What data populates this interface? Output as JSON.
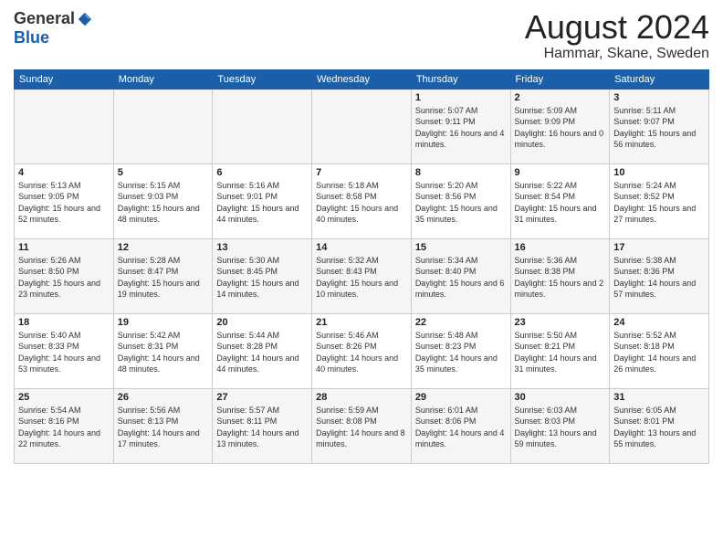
{
  "logo": {
    "general": "General",
    "blue": "Blue"
  },
  "title": "August 2024",
  "location": "Hammar, Skane, Sweden",
  "days_of_week": [
    "Sunday",
    "Monday",
    "Tuesday",
    "Wednesday",
    "Thursday",
    "Friday",
    "Saturday"
  ],
  "weeks": [
    [
      {
        "day": "",
        "info": ""
      },
      {
        "day": "",
        "info": ""
      },
      {
        "day": "",
        "info": ""
      },
      {
        "day": "",
        "info": ""
      },
      {
        "day": "1",
        "sunrise": "5:07 AM",
        "sunset": "9:11 PM",
        "daylight": "Daylight: 16 hours and 4 minutes."
      },
      {
        "day": "2",
        "sunrise": "5:09 AM",
        "sunset": "9:09 PM",
        "daylight": "Daylight: 16 hours and 0 minutes."
      },
      {
        "day": "3",
        "sunrise": "5:11 AM",
        "sunset": "9:07 PM",
        "daylight": "Daylight: 15 hours and 56 minutes."
      }
    ],
    [
      {
        "day": "4",
        "sunrise": "5:13 AM",
        "sunset": "9:05 PM",
        "daylight": "Daylight: 15 hours and 52 minutes."
      },
      {
        "day": "5",
        "sunrise": "5:15 AM",
        "sunset": "9:03 PM",
        "daylight": "Daylight: 15 hours and 48 minutes."
      },
      {
        "day": "6",
        "sunrise": "5:16 AM",
        "sunset": "9:01 PM",
        "daylight": "Daylight: 15 hours and 44 minutes."
      },
      {
        "day": "7",
        "sunrise": "5:18 AM",
        "sunset": "8:58 PM",
        "daylight": "Daylight: 15 hours and 40 minutes."
      },
      {
        "day": "8",
        "sunrise": "5:20 AM",
        "sunset": "8:56 PM",
        "daylight": "Daylight: 15 hours and 35 minutes."
      },
      {
        "day": "9",
        "sunrise": "5:22 AM",
        "sunset": "8:54 PM",
        "daylight": "Daylight: 15 hours and 31 minutes."
      },
      {
        "day": "10",
        "sunrise": "5:24 AM",
        "sunset": "8:52 PM",
        "daylight": "Daylight: 15 hours and 27 minutes."
      }
    ],
    [
      {
        "day": "11",
        "sunrise": "5:26 AM",
        "sunset": "8:50 PM",
        "daylight": "Daylight: 15 hours and 23 minutes."
      },
      {
        "day": "12",
        "sunrise": "5:28 AM",
        "sunset": "8:47 PM",
        "daylight": "Daylight: 15 hours and 19 minutes."
      },
      {
        "day": "13",
        "sunrise": "5:30 AM",
        "sunset": "8:45 PM",
        "daylight": "Daylight: 15 hours and 14 minutes."
      },
      {
        "day": "14",
        "sunrise": "5:32 AM",
        "sunset": "8:43 PM",
        "daylight": "Daylight: 15 hours and 10 minutes."
      },
      {
        "day": "15",
        "sunrise": "5:34 AM",
        "sunset": "8:40 PM",
        "daylight": "Daylight: 15 hours and 6 minutes."
      },
      {
        "day": "16",
        "sunrise": "5:36 AM",
        "sunset": "8:38 PM",
        "daylight": "Daylight: 15 hours and 2 minutes."
      },
      {
        "day": "17",
        "sunrise": "5:38 AM",
        "sunset": "8:36 PM",
        "daylight": "Daylight: 14 hours and 57 minutes."
      }
    ],
    [
      {
        "day": "18",
        "sunrise": "5:40 AM",
        "sunset": "8:33 PM",
        "daylight": "Daylight: 14 hours and 53 minutes."
      },
      {
        "day": "19",
        "sunrise": "5:42 AM",
        "sunset": "8:31 PM",
        "daylight": "Daylight: 14 hours and 48 minutes."
      },
      {
        "day": "20",
        "sunrise": "5:44 AM",
        "sunset": "8:28 PM",
        "daylight": "Daylight: 14 hours and 44 minutes."
      },
      {
        "day": "21",
        "sunrise": "5:46 AM",
        "sunset": "8:26 PM",
        "daylight": "Daylight: 14 hours and 40 minutes."
      },
      {
        "day": "22",
        "sunrise": "5:48 AM",
        "sunset": "8:23 PM",
        "daylight": "Daylight: 14 hours and 35 minutes."
      },
      {
        "day": "23",
        "sunrise": "5:50 AM",
        "sunset": "8:21 PM",
        "daylight": "Daylight: 14 hours and 31 minutes."
      },
      {
        "day": "24",
        "sunrise": "5:52 AM",
        "sunset": "8:18 PM",
        "daylight": "Daylight: 14 hours and 26 minutes."
      }
    ],
    [
      {
        "day": "25",
        "sunrise": "5:54 AM",
        "sunset": "8:16 PM",
        "daylight": "Daylight: 14 hours and 22 minutes."
      },
      {
        "day": "26",
        "sunrise": "5:56 AM",
        "sunset": "8:13 PM",
        "daylight": "Daylight: 14 hours and 17 minutes."
      },
      {
        "day": "27",
        "sunrise": "5:57 AM",
        "sunset": "8:11 PM",
        "daylight": "Daylight: 14 hours and 13 minutes."
      },
      {
        "day": "28",
        "sunrise": "5:59 AM",
        "sunset": "8:08 PM",
        "daylight": "Daylight: 14 hours and 8 minutes."
      },
      {
        "day": "29",
        "sunrise": "6:01 AM",
        "sunset": "8:06 PM",
        "daylight": "Daylight: 14 hours and 4 minutes."
      },
      {
        "day": "30",
        "sunrise": "6:03 AM",
        "sunset": "8:03 PM",
        "daylight": "Daylight: 13 hours and 59 minutes."
      },
      {
        "day": "31",
        "sunrise": "6:05 AM",
        "sunset": "8:01 PM",
        "daylight": "Daylight: 13 hours and 55 minutes."
      }
    ]
  ]
}
